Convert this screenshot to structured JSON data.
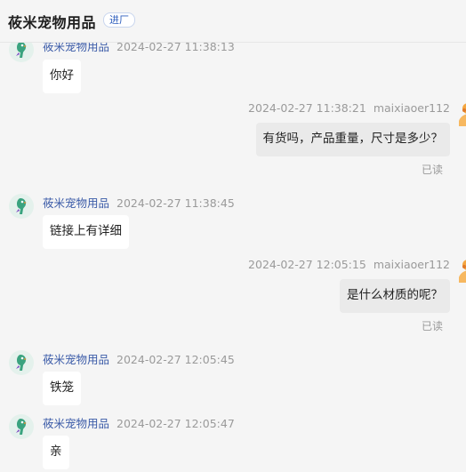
{
  "header": {
    "title": "莜米宠物用品",
    "badge": "进厂"
  },
  "messages": [
    {
      "side": "in",
      "name": "莜米宠物用品",
      "time": "2024-02-27 11:38:13",
      "text": "你好"
    },
    {
      "side": "out",
      "name": "maixiaoer112",
      "time": "2024-02-27 11:38:21",
      "text": "有货吗，产品重量，尺寸是多少？",
      "status": "已读"
    },
    {
      "side": "in",
      "name": "莜米宠物用品",
      "time": "2024-02-27 11:38:45",
      "text": "链接上有详细"
    },
    {
      "side": "out",
      "name": "maixiaoer112",
      "time": "2024-02-27 12:05:15",
      "text": "是什么材质的呢？",
      "status": "已读"
    },
    {
      "side": "in",
      "name": "莜米宠物用品",
      "time": "2024-02-27 12:05:45",
      "text": "铁笼"
    },
    {
      "side": "in",
      "name": "莜米宠物用品",
      "time": "2024-02-27 12:05:47",
      "text": "亲"
    }
  ],
  "icons": {
    "shop_avatar": "parrot-logo-icon",
    "self_avatar": "user-avatar-icon"
  },
  "colors": {
    "sender_name": "#3b5ba8",
    "muted": "#9a9a9a",
    "incoming_bubble": "#ffffff",
    "outgoing_bubble": "#eaeaea"
  }
}
